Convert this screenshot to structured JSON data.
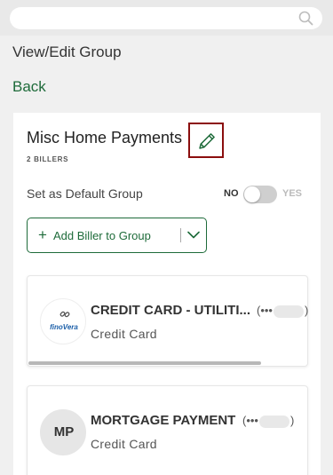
{
  "search": {
    "placeholder": ""
  },
  "header": {
    "title": "View/Edit Group",
    "back_label": "Back"
  },
  "group": {
    "name": "Misc Home Payments",
    "billers_count": "2 BILLERS",
    "default_label": "Set as Default Group",
    "toggle_off_label": "NO",
    "toggle_on_label": "YES",
    "is_default": false,
    "add_biller_label": "Add Biller to Group"
  },
  "billers": [
    {
      "name": "CREDIT CARD - UTILITI...",
      "masked_prefix": "(•••",
      "masked_suffix": ")",
      "type": "Credit Card",
      "logo_text": "finoVera"
    },
    {
      "name": "MORTGAGE PAYMENT",
      "masked_prefix": "(•••",
      "masked_suffix": ")",
      "type": "Credit Card",
      "initials": "MP"
    }
  ],
  "colors": {
    "brand_green": "#1e6b3a",
    "edit_highlight": "#8b0e0e"
  },
  "icons": {
    "search": "search-icon",
    "edit": "pencil-icon",
    "add": "plus-icon",
    "dropdown": "chevron-down-icon"
  }
}
